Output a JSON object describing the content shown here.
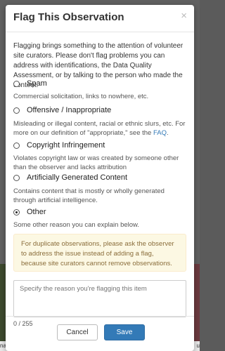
{
  "modal": {
    "title": "Flag This Observation",
    "close_glyph": "×",
    "intro": "Flagging brings something to the attention of volunteer site curators. Please don't flag problems you can address with identifications, the Data Quality Assessment, or by talking to the person who made the content."
  },
  "options": [
    {
      "label": "Spam",
      "checked": false,
      "description": "Commercial solicitation, links to nowhere, etc."
    },
    {
      "label": "Offensive / Inappropriate",
      "checked": false,
      "description_before": "Misleading or illegal content, racial or ethnic slurs, etc. For more on our definition of \"appropriate,\" see the ",
      "description_link": "FAQ",
      "description_after": "."
    },
    {
      "label": "Copyright Infringement",
      "checked": false,
      "description": "Violates copyright law or was created by someone other than the observer and lacks attribution"
    },
    {
      "label": "Artificially Generated Content",
      "checked": false,
      "description": "Contains content that is mostly or wholly generated through artificial intelligence."
    },
    {
      "label": "Other",
      "checked": true,
      "description": "Some other reason you can explain below."
    }
  ],
  "alert": "For duplicate observations, please ask the observer to address the issue instead of adding a flag, because site curators cannot remove observations.",
  "reason": {
    "placeholder": "Specify the reason you're flagging this item",
    "value": ""
  },
  "counter": "0 / 255",
  "buttons": {
    "cancel": "Cancel",
    "save": "Save"
  },
  "backdrop": {
    "left_fragment": "na",
    "right_fragment": "u"
  },
  "colors": {
    "primary": "#337ab7",
    "alert_bg": "#fcf8e3",
    "alert_text": "#8a6d3b",
    "link": "#337ab7"
  }
}
